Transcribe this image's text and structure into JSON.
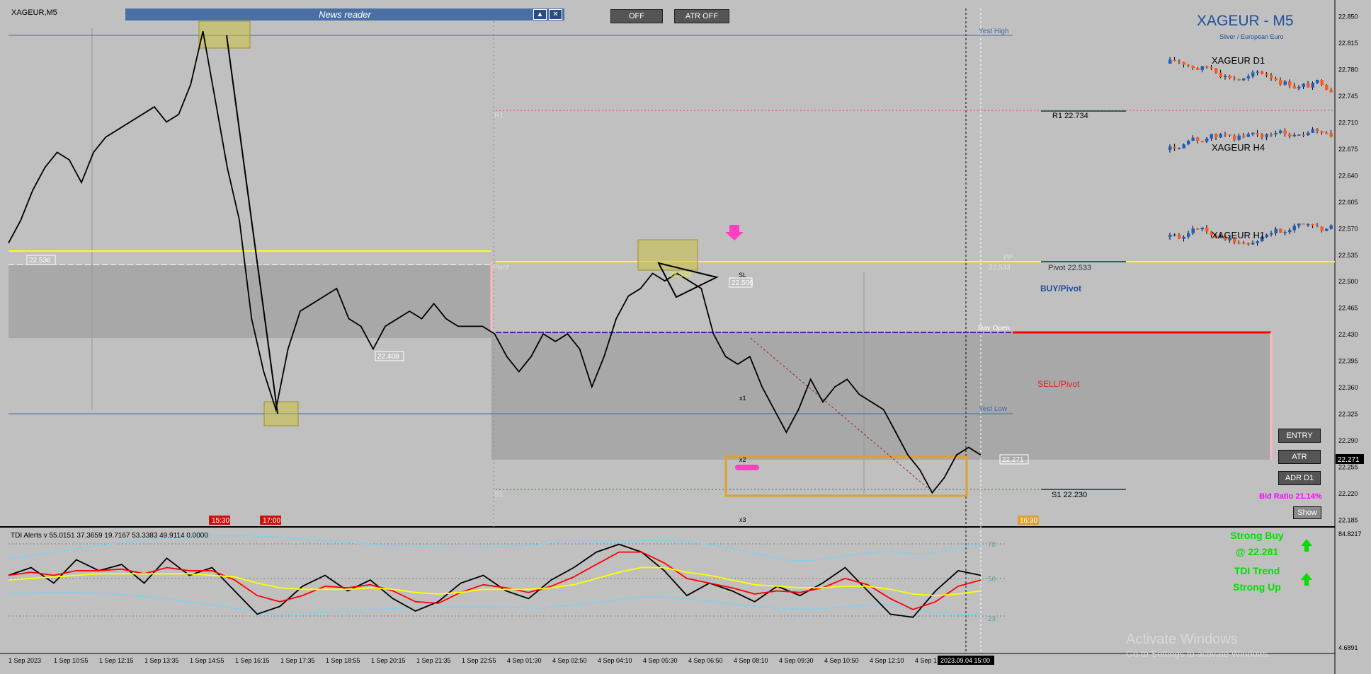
{
  "header": {
    "symbol_label": "XAGEUR,M5",
    "news_reader": "News reader",
    "off_button": "OFF",
    "atr_off_button": "ATR OFF",
    "title": "XAGEUR - M5",
    "subtitle": "Silver / European Euro"
  },
  "levels": {
    "yest_high": "Yest High",
    "r1_left": "R1",
    "r1_right": "R1 22.734",
    "pp": "PP",
    "pp_value": "22.533",
    "pivot_left": "Pivot",
    "pivot_right": "Pivot 22.533",
    "buy_pivot": "BUY/Pivot",
    "day_open": "Day Open",
    "sell_pivot": "SELL/Pivot",
    "yest_low": "Yest Low",
    "s1_left": "S1",
    "s1_right": "S1 22.230"
  },
  "price_tags": {
    "t1": "22.536",
    "t2": "22.408",
    "t3": "22.533",
    "t4": "22.506",
    "t5": "22.271",
    "sl": "SL",
    "x1": "x1",
    "x2": "x2",
    "x3": "x3",
    "time1": "15:30",
    "time2": "17:00",
    "time3": "16:30"
  },
  "right_buttons": {
    "entry": "ENTRY",
    "atr": "ATR",
    "adr": "ADR D1",
    "bid_ratio": "Bid Ratio 21.14%",
    "show": "Show"
  },
  "mini_charts": {
    "d1": "XAGEUR D1",
    "h4": "XAGEUR H4",
    "h1": "XAGEUR H1"
  },
  "indicator": {
    "label": "TDI Alerts v 55.0151 37.3659 19.7167 53.3383 49.9114 0.0000",
    "signal_line1": "Strong Buy",
    "signal_line2": "@ 22.281",
    "trend_line1": "TDI Trend",
    "trend_line2": "Strong Up",
    "level_78": "78",
    "level_50": "50",
    "level_23": "23",
    "axis_top": "84.8217",
    "axis_bottom": "4.6891"
  },
  "watermark": {
    "line1": "Activate Windows",
    "line2": "Go to Settings to activate Windows."
  },
  "chart_data": [
    {
      "type": "candlestick",
      "title": "XAGEUR,M5",
      "y_ticks": [
        "22.850",
        "22.815",
        "22.780",
        "22.745",
        "22.710",
        "22.675",
        "22.640",
        "22.605",
        "22.570",
        "22.535",
        "22.500",
        "22.465",
        "22.430",
        "22.395",
        "22.360",
        "22.325",
        "22.290",
        "22.255",
        "22.220",
        "22.185"
      ],
      "y_tick_values": [
        22.85,
        22.815,
        22.78,
        22.745,
        22.71,
        22.675,
        22.64,
        22.605,
        22.57,
        22.535,
        22.5,
        22.465,
        22.43,
        22.395,
        22.36,
        22.325,
        22.29,
        22.255,
        22.22,
        22.185
      ],
      "current_price": "22.271",
      "x_ticks": [
        "1 Sep 2023",
        "1 Sep 10:55",
        "1 Sep 12:15",
        "1 Sep 13:35",
        "1 Sep 14:55",
        "1 Sep 16:15",
        "1 Sep 17:35",
        "1 Sep 18:55",
        "1 Sep 20:15",
        "1 Sep 21:35",
        "1 Sep 22:55",
        "4 Sep 01:30",
        "4 Sep 02:50",
        "4 Sep 04:10",
        "4 Sep 05:30",
        "4 Sep 06:50",
        "4 Sep 08:10",
        "4 Sep 09:30",
        "4 Sep 10:50",
        "4 Sep 12:10",
        "4 Sep 1",
        "2023.09.04 15:00"
      ],
      "ylim": [
        22.175,
        22.86
      ],
      "close_path": [
        22.55,
        22.58,
        22.62,
        22.65,
        22.67,
        22.66,
        22.63,
        22.67,
        22.69,
        22.7,
        22.71,
        22.72,
        22.73,
        22.71,
        22.72,
        22.76,
        22.83,
        22.74,
        22.65,
        22.58,
        22.45,
        22.38,
        22.33,
        22.41,
        22.46,
        22.47,
        22.48,
        22.49,
        22.45,
        22.44,
        22.41,
        22.44,
        22.45,
        22.46,
        22.45,
        22.47,
        22.45,
        22.44,
        22.44,
        22.44,
        22.43,
        22.4,
        22.38,
        22.4,
        22.43,
        22.42,
        22.43,
        22.41,
        22.36,
        22.4,
        22.45,
        22.48,
        22.49,
        22.51,
        22.5,
        22.51,
        22.5,
        22.49,
        22.43,
        22.4,
        22.39,
        22.4,
        22.36,
        22.33,
        22.3,
        22.33,
        22.37,
        22.34,
        22.36,
        22.37,
        22.35,
        22.34,
        22.33,
        22.3,
        22.27,
        22.25,
        22.22,
        22.24,
        22.27,
        22.28,
        22.27
      ]
    },
    {
      "type": "line",
      "title": "TDI Alerts",
      "y_levels": [
        78,
        50,
        23
      ],
      "ylim": [
        4.6891,
        84.8217
      ],
      "series": [
        {
          "color": "#000000",
          "values": [
            55,
            60,
            50,
            65,
            58,
            62,
            50,
            66,
            55,
            60,
            45,
            30,
            35,
            48,
            55,
            45,
            52,
            40,
            32,
            38,
            50,
            55,
            45,
            40,
            52,
            60,
            70,
            75,
            70,
            58,
            42,
            50,
            45,
            38,
            48,
            42,
            50,
            60,
            45,
            30,
            28,
            45,
            58,
            55
          ]
        },
        {
          "color": "#ff0000",
          "values": [
            55,
            57,
            55,
            58,
            58,
            59,
            56,
            60,
            58,
            58,
            52,
            42,
            38,
            42,
            48,
            47,
            49,
            45,
            38,
            37,
            44,
            49,
            47,
            44,
            48,
            54,
            62,
            70,
            70,
            63,
            53,
            50,
            47,
            43,
            45,
            44,
            47,
            53,
            49,
            40,
            33,
            38,
            48,
            52
          ]
        },
        {
          "color": "#ffff00",
          "values": [
            52,
            53,
            54,
            55,
            56,
            56,
            56,
            56,
            56,
            55,
            54,
            50,
            47,
            46,
            46,
            46,
            47,
            46,
            44,
            43,
            44,
            46,
            46,
            46,
            47,
            49,
            53,
            57,
            60,
            60,
            57,
            55,
            52,
            49,
            48,
            47,
            47,
            48,
            48,
            46,
            43,
            42,
            43,
            45
          ]
        }
      ]
    }
  ],
  "colors": {
    "background": "#c0c0c0",
    "zone_dark": "#a8a8a8",
    "pivot_line": "#ffff00",
    "day_open_line": "#ff0000",
    "signal_green": "#00e000",
    "title_blue": "#1f4e9a"
  }
}
